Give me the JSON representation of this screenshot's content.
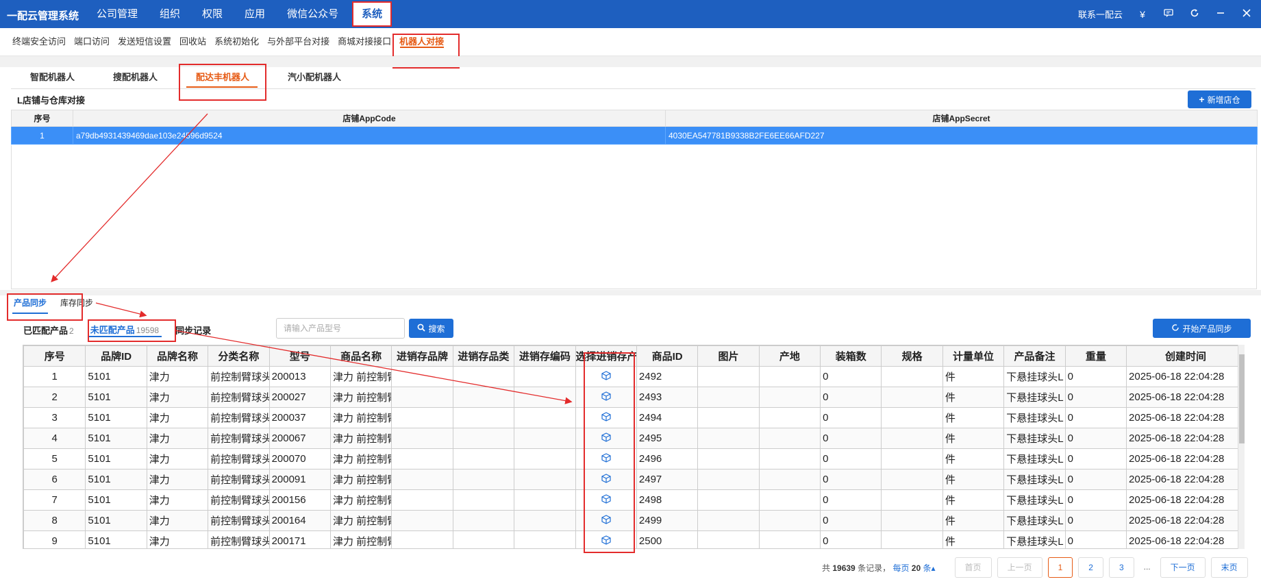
{
  "app": {
    "title": "一配云管理系统"
  },
  "topnav": [
    {
      "label": "公司管理"
    },
    {
      "label": "组织"
    },
    {
      "label": "权限"
    },
    {
      "label": "应用"
    },
    {
      "label": "微信公众号"
    },
    {
      "label": "系统"
    }
  ],
  "topright": {
    "contact": "联系一配云",
    "currency_icon": "¥"
  },
  "subnav": [
    {
      "label": "终端安全访问"
    },
    {
      "label": "端口访问"
    },
    {
      "label": "发送短信设置"
    },
    {
      "label": "回收站"
    },
    {
      "label": "系统初始化"
    },
    {
      "label": "与外部平台对接"
    },
    {
      "label": "商城对接接口"
    },
    {
      "label": "机器人对接"
    }
  ],
  "robot_tabs": [
    {
      "label": "智配机器人"
    },
    {
      "label": "搜配机器人"
    },
    {
      "label": "配达丰机器人"
    },
    {
      "label": "汽小配机器人"
    }
  ],
  "shop_section": {
    "title": "L店铺与仓库对接",
    "add_button": "新增店仓",
    "columns": [
      "序号",
      "店铺AppCode",
      "店铺AppSecret"
    ],
    "rows": [
      {
        "seq": "1",
        "code": "a79db4931439469dae103e24596d9524",
        "secret": "4030EA547781B9338B2FE6EE66AFD227"
      }
    ]
  },
  "sync_tabs": [
    {
      "label": "产品同步"
    },
    {
      "label": "库存同步"
    }
  ],
  "filters": {
    "matched": {
      "label": "已匹配产品",
      "count": "2"
    },
    "unmatched": {
      "label": "未匹配产品",
      "count": "19598"
    },
    "records": {
      "label": "同步记录"
    }
  },
  "search": {
    "placeholder": "请输入产品型号",
    "button": "搜索"
  },
  "sync_button": "开始产品同步",
  "product_table": {
    "columns": [
      "序号",
      "品牌ID",
      "品牌名称",
      "分类名称",
      "型号",
      "商品名称",
      "进销存品牌",
      "进销存品类",
      "进销存编码",
      "选择进销存产品",
      "商品ID",
      "图片",
      "产地",
      "装箱数",
      "规格",
      "计量单位",
      "产品备注",
      "重量",
      "创建时间"
    ],
    "rows": [
      {
        "seq": "1",
        "brand_id": "5101",
        "brand": "津力",
        "category": "前控制臂球头",
        "model": "200013",
        "name": "津力 前控制臂",
        "pid": "2492",
        "box": "0",
        "unit": "件",
        "note": "下悬挂球头L",
        "weight": "0",
        "time": "2025-06-18 22:04:28"
      },
      {
        "seq": "2",
        "brand_id": "5101",
        "brand": "津力",
        "category": "前控制臂球头",
        "model": "200027",
        "name": "津力 前控制臂",
        "pid": "2493",
        "box": "0",
        "unit": "件",
        "note": "下悬挂球头L",
        "weight": "0",
        "time": "2025-06-18 22:04:28"
      },
      {
        "seq": "3",
        "brand_id": "5101",
        "brand": "津力",
        "category": "前控制臂球头",
        "model": "200037",
        "name": "津力 前控制臂",
        "pid": "2494",
        "box": "0",
        "unit": "件",
        "note": "下悬挂球头L",
        "weight": "0",
        "time": "2025-06-18 22:04:28"
      },
      {
        "seq": "4",
        "brand_id": "5101",
        "brand": "津力",
        "category": "前控制臂球头",
        "model": "200067",
        "name": "津力 前控制臂",
        "pid": "2495",
        "box": "0",
        "unit": "件",
        "note": "下悬挂球头L",
        "weight": "0",
        "time": "2025-06-18 22:04:28"
      },
      {
        "seq": "5",
        "brand_id": "5101",
        "brand": "津力",
        "category": "前控制臂球头",
        "model": "200070",
        "name": "津力 前控制臂",
        "pid": "2496",
        "box": "0",
        "unit": "件",
        "note": "下悬挂球头L",
        "weight": "0",
        "time": "2025-06-18 22:04:28"
      },
      {
        "seq": "6",
        "brand_id": "5101",
        "brand": "津力",
        "category": "前控制臂球头",
        "model": "200091",
        "name": "津力 前控制臂",
        "pid": "2497",
        "box": "0",
        "unit": "件",
        "note": "下悬挂球头L",
        "weight": "0",
        "time": "2025-06-18 22:04:28"
      },
      {
        "seq": "7",
        "brand_id": "5101",
        "brand": "津力",
        "category": "前控制臂球头",
        "model": "200156",
        "name": "津力 前控制臂",
        "pid": "2498",
        "box": "0",
        "unit": "件",
        "note": "下悬挂球头L",
        "weight": "0",
        "time": "2025-06-18 22:04:28"
      },
      {
        "seq": "8",
        "brand_id": "5101",
        "brand": "津力",
        "category": "前控制臂球头",
        "model": "200164",
        "name": "津力 前控制臂",
        "pid": "2499",
        "box": "0",
        "unit": "件",
        "note": "下悬挂球头L",
        "weight": "0",
        "time": "2025-06-18 22:04:28"
      },
      {
        "seq": "9",
        "brand_id": "5101",
        "brand": "津力",
        "category": "前控制臂球头",
        "model": "200171",
        "name": "津力 前控制臂",
        "pid": "2500",
        "box": "0",
        "unit": "件",
        "note": "下悬挂球头L",
        "weight": "0",
        "time": "2025-06-18 22:04:28"
      }
    ]
  },
  "pager": {
    "total_prefix": "共",
    "total": "19639",
    "total_suffix": "条记录，",
    "per_page_prefix": "每页",
    "per_page": "20",
    "per_page_suffix": "条",
    "first": "首页",
    "prev": "上一页",
    "pages": [
      "1",
      "2",
      "3"
    ],
    "dots": "...",
    "next": "下一页",
    "last": "末页"
  },
  "colors": {
    "nav": "#1e5fbf",
    "accent": "#e65a14",
    "primary": "#1e6ed6",
    "annotation": "#e32b2b",
    "selected_row": "#3b8ff7"
  }
}
